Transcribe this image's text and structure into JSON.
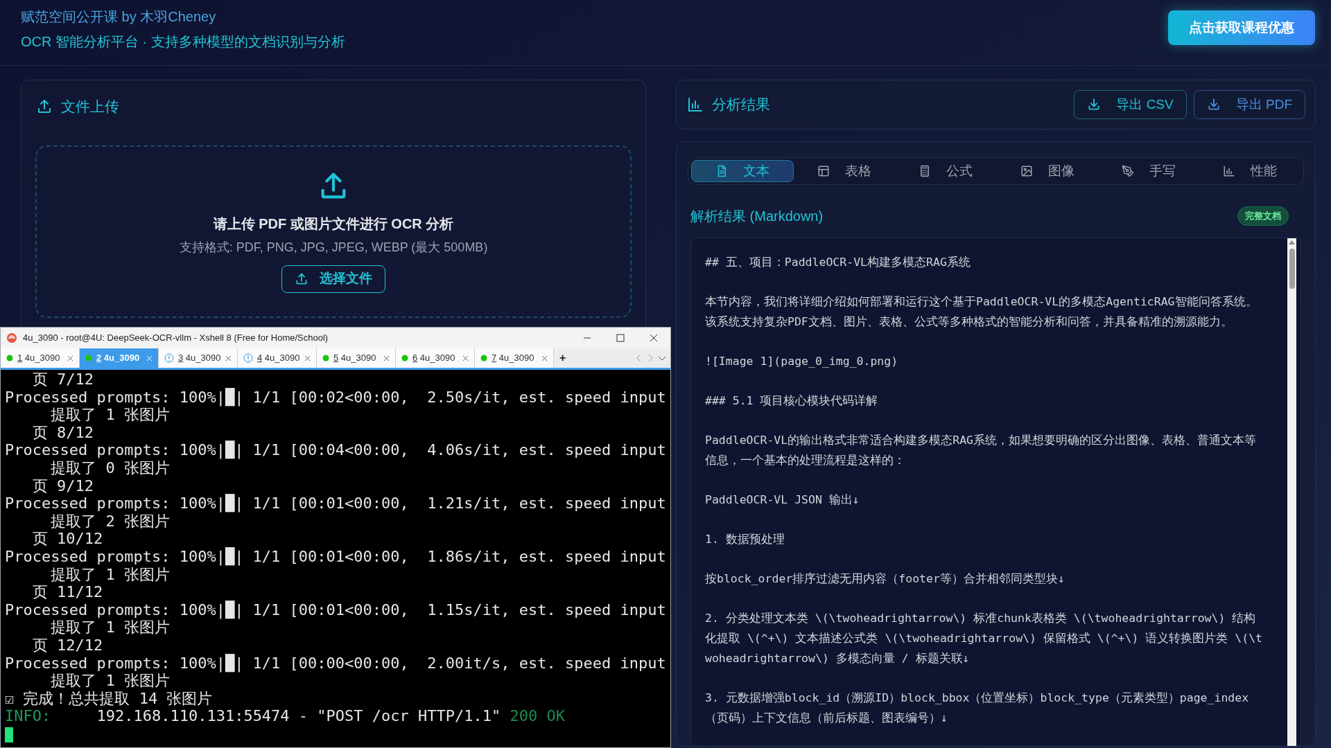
{
  "header": {
    "title": "赋范空间公开课 by 木羽Cheney",
    "subtitle": "OCR 智能分析平台 · 支持多种模型的文档识别与分析",
    "promo_button": "点击获取课程优惠"
  },
  "upload_panel": {
    "title": "文件上传",
    "prompt": "请上传 PDF 或图片文件进行 OCR 分析",
    "formats": "支持格式: PDF, PNG, JPG, JPEG, WEBP (最大 500MB)",
    "button": "选择文件"
  },
  "results_panel": {
    "title": "分析结果",
    "export_buttons": [
      {
        "label": "导出 CSV",
        "kind": "csv"
      },
      {
        "label": "导出 PDF",
        "kind": "pdf"
      }
    ],
    "tabs": [
      {
        "label": "文本",
        "kind": "text",
        "selected": true
      },
      {
        "label": "表格",
        "kind": "table",
        "selected": false
      },
      {
        "label": "公式",
        "kind": "formula",
        "selected": false
      },
      {
        "label": "图像",
        "kind": "image",
        "selected": false
      },
      {
        "label": "手写",
        "kind": "handwriting",
        "selected": false
      },
      {
        "label": "性能",
        "kind": "performance",
        "selected": false
      }
    ],
    "section_title": "解析结果 (Markdown)",
    "badge": "完整文档",
    "markdown_paragraphs": [
      "## 五、项目：PaddleOCR-VL构建多模态RAG系统",
      "本节内容，我们将详细介绍如何部署和运行这个基于PaddleOCR-VL的多模态AgenticRAG智能问答系统。该系统支持复杂PDF文档、图片、表格、公式等多种格式的智能分析和问答，并具备精准的溯源能力。",
      "![Image 1](page_0_img_0.png)",
      "### 5.1 项目核心模块代码详解",
      "PaddleOCR-VL的输出格式非常适合构建多模态RAG系统，如果想要明确的区分出图像、表格、普通文本等信息，一个基本的处理流程是这样的：",
      "PaddleOCR-VL JSON 输出↓",
      "1. 数据预处理",
      "按block_order排序过滤无用内容（footer等）合并相邻同类型块↓",
      "2. 分类处理文本类 \\(\\twoheadrightarrow\\) 标准chunk表格类 \\(\\twoheadrightarrow\\) 结构化提取 \\(^+\\) 文本描述公式类 \\(\\twoheadrightarrow\\) 保留格式 \\(^+\\) 语义转换图片类 \\(\\twoheadrightarrow\\) 多模态向量 / 标题关联↓",
      "3. 元数据增强block_id（溯源ID）block_bbox（位置坐标）block_type（元素类型）page_index（页码）上下文信息（前后标题、图表编号）↓"
    ]
  },
  "terminal_window": {
    "title": "4u_3090 - root@4U: DeepSeek-OCR-vllm - Xshell 8 (Free for Home/School)",
    "tabs": [
      {
        "number": "1",
        "name": "4u_3090",
        "connected": true,
        "selected": false
      },
      {
        "number": "2",
        "name": "4u_3090",
        "connected": true,
        "selected": true
      },
      {
        "number": "3",
        "name": "4u_3090",
        "connected": false,
        "selected": false
      },
      {
        "number": "4",
        "name": "4u_3090",
        "connected": false,
        "selected": false
      },
      {
        "number": "5",
        "name": "4u_3090",
        "connected": true,
        "selected": false
      },
      {
        "number": "6",
        "name": "4u_3090",
        "connected": true,
        "selected": false
      },
      {
        "number": "7",
        "name": "4u_3090",
        "connected": true,
        "selected": false
      }
    ],
    "new_tab_button": "+",
    "lines": [
      {
        "kind": "text",
        "text": "   页 7/12"
      },
      {
        "kind": "text",
        "text": "Processed prompts: 100%|█| 1/1 [00:02<00:00,  2.50s/it, est. speed input"
      },
      {
        "kind": "text",
        "text": "     提取了 1 张图片"
      },
      {
        "kind": "text",
        "text": "   页 8/12"
      },
      {
        "kind": "text",
        "text": "Processed prompts: 100%|█| 1/1 [00:04<00:00,  4.06s/it, est. speed input"
      },
      {
        "kind": "text",
        "text": "     提取了 0 张图片"
      },
      {
        "kind": "text",
        "text": "   页 9/12"
      },
      {
        "kind": "text",
        "text": "Processed prompts: 100%|█| 1/1 [00:01<00:00,  1.21s/it, est. speed input"
      },
      {
        "kind": "text",
        "text": "     提取了 2 张图片"
      },
      {
        "kind": "text",
        "text": "   页 10/12"
      },
      {
        "kind": "text",
        "text": "Processed prompts: 100%|█| 1/1 [00:01<00:00,  1.86s/it, est. speed input"
      },
      {
        "kind": "text",
        "text": "     提取了 1 张图片"
      },
      {
        "kind": "text",
        "text": "   页 11/12"
      },
      {
        "kind": "text",
        "text": "Processed prompts: 100%|█| 1/1 [00:01<00:00,  1.15s/it, est. speed input"
      },
      {
        "kind": "text",
        "text": "     提取了 1 张图片"
      },
      {
        "kind": "text",
        "text": "   页 12/12"
      },
      {
        "kind": "text",
        "text": "Processed prompts: 100%|█| 1/1 [00:00<00:00,  2.00it/s, est. speed input"
      },
      {
        "kind": "text",
        "text": "     提取了 1 张图片"
      },
      {
        "kind": "text",
        "text": "☑ 完成！总共提取 14 张图片"
      },
      {
        "kind": "log",
        "level": "INFO:",
        "message": "     192.168.110.131:55474 - \"POST /ocr HTTP/1.1\"",
        "status": "200 OK"
      }
    ]
  }
}
